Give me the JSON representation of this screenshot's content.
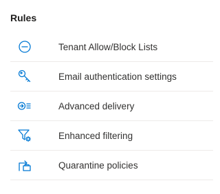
{
  "section": {
    "title": "Rules"
  },
  "theme": {
    "accent": "#0078d4",
    "divider": "#edebe9",
    "text": "#323130"
  },
  "rules": [
    {
      "label": "Tenant Allow/Block Lists",
      "icon": "minus-circle-icon"
    },
    {
      "label": "Email authentication settings",
      "icon": "key-icon"
    },
    {
      "label": "Advanced delivery",
      "icon": "advanced-delivery-icon"
    },
    {
      "label": "Enhanced filtering",
      "icon": "filter-settings-icon"
    },
    {
      "label": "Quarantine policies",
      "icon": "quarantine-policy-icon"
    }
  ]
}
